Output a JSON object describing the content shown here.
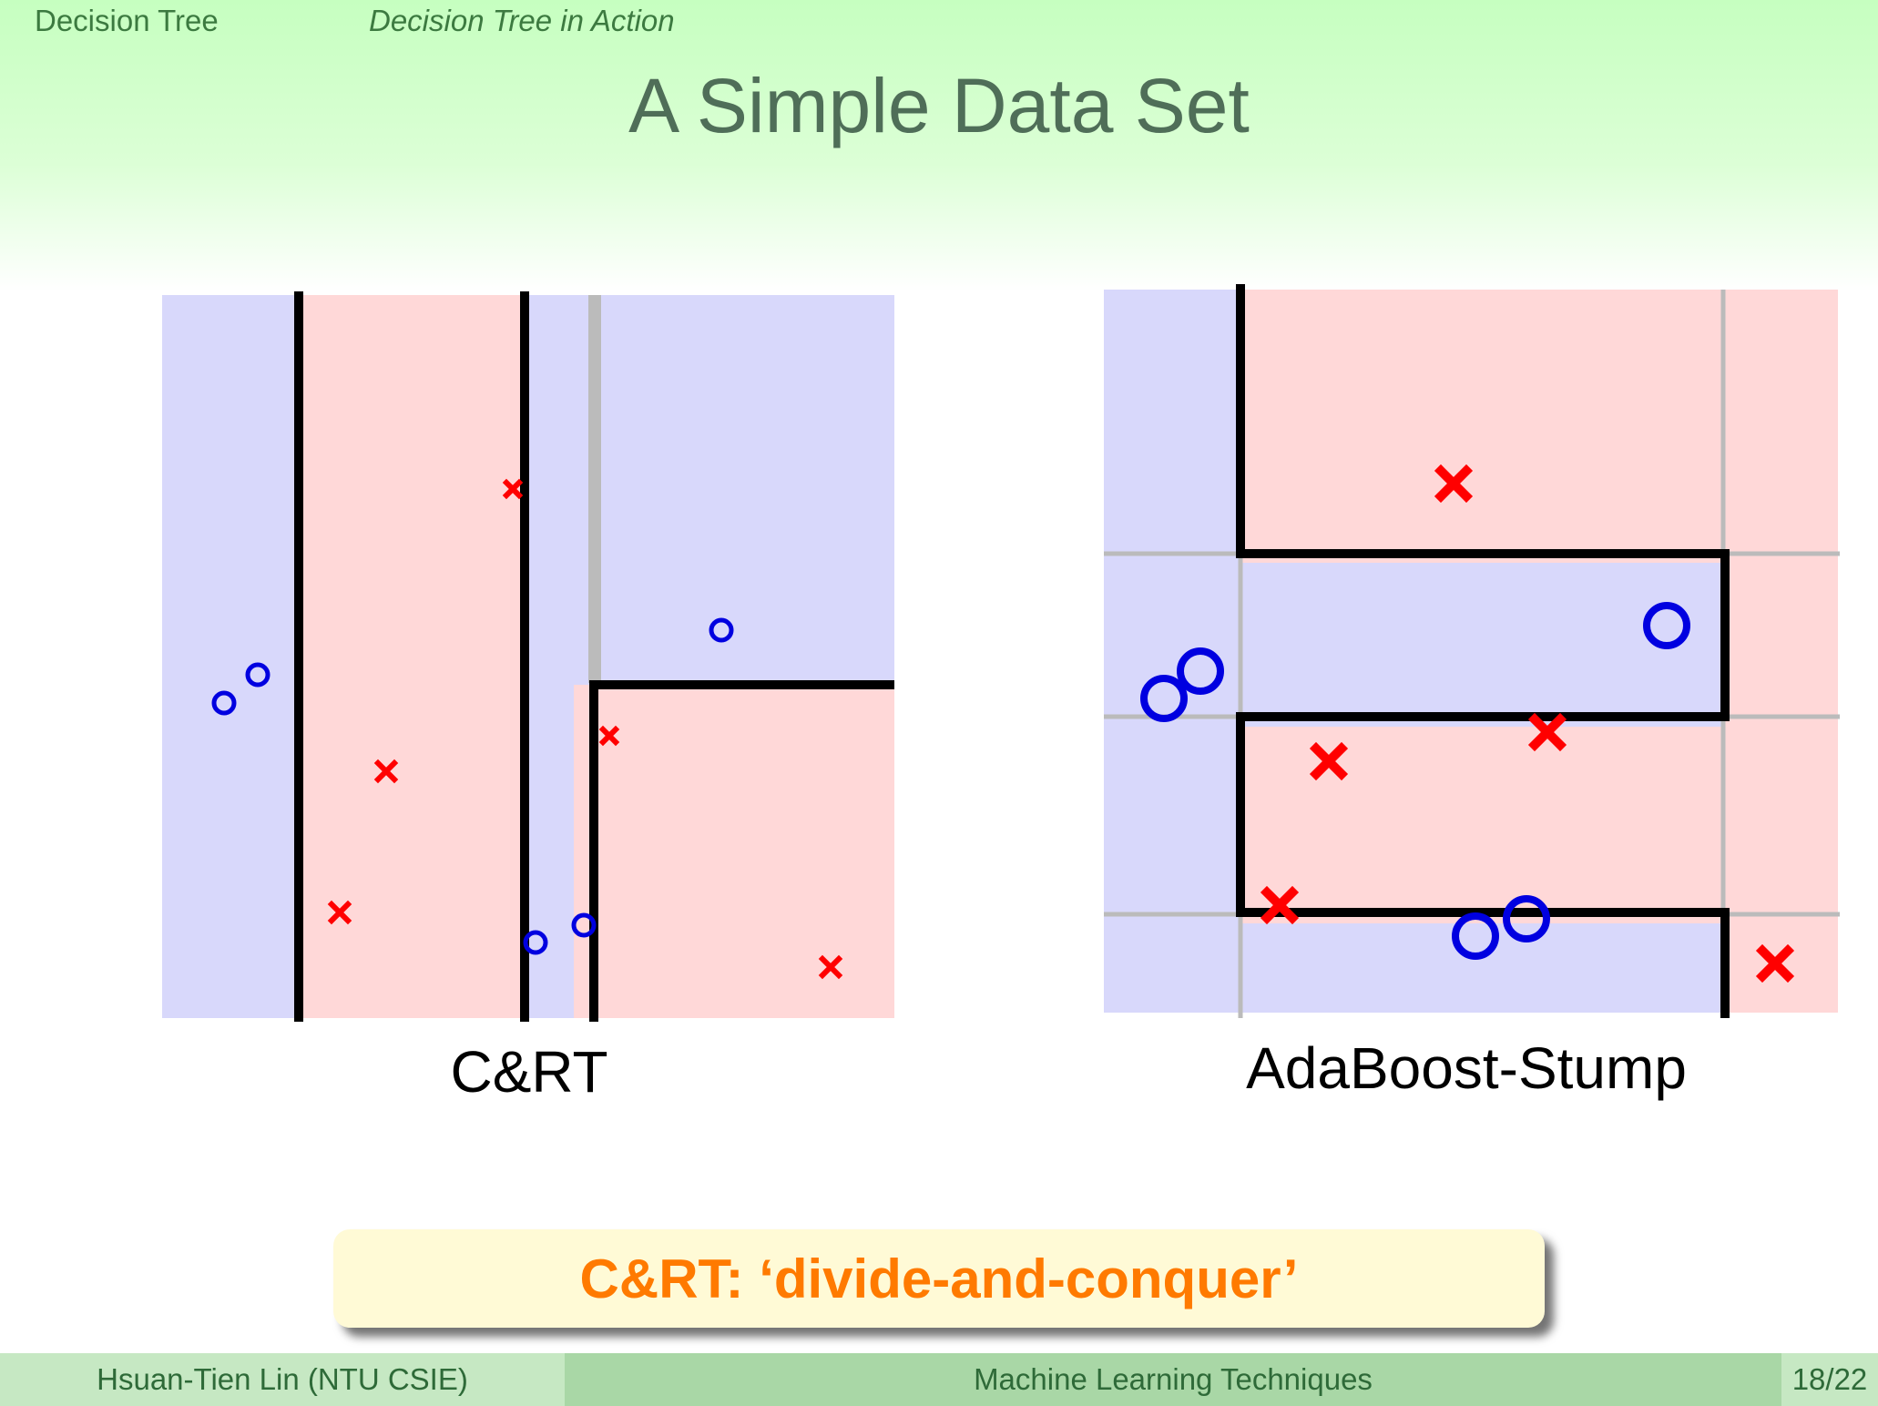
{
  "header": {
    "section": "Decision Tree",
    "subsection": "Decision Tree in Action"
  },
  "slide": {
    "title": "A Simple Data Set"
  },
  "colors": {
    "class_o_region": "#d8d8fb",
    "class_x_region": "#ffd8d8",
    "class_o_marker": "#0000e0",
    "class_x_marker": "#ff0000",
    "boundary": "#000000",
    "stump_line": "#bbbbbb",
    "callout_text": "#ff7a00",
    "callout_bg": "#fffad6"
  },
  "panels": {
    "cart": {
      "caption": "C&RT"
    },
    "adaboost": {
      "caption": "AdaBoost-Stump"
    }
  },
  "callout": {
    "text": "C&RT: ‘divide-and-conquer’"
  },
  "footer": {
    "author": "Hsuan-Tien Lin  (NTU CSIE)",
    "course": "Machine Learning Techniques",
    "page": "18/22"
  }
}
